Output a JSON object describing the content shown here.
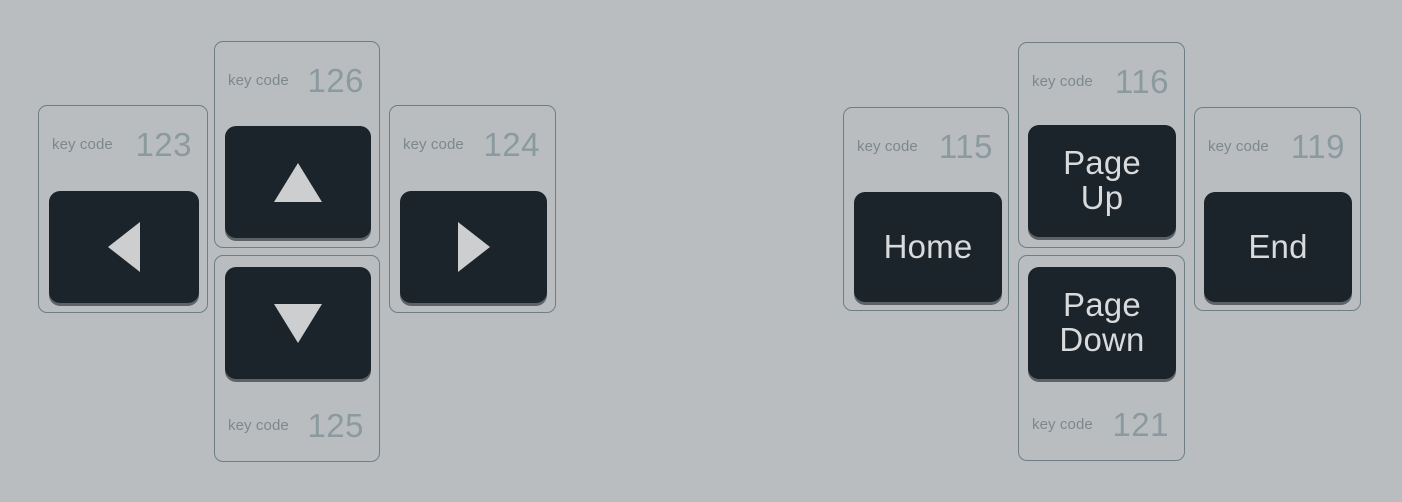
{
  "page": {
    "background_color": "#b9bdc0",
    "card_border_color": "#6d7f85",
    "keycap_color": "#1b242a",
    "keycap_text_color": "#d8dadb",
    "meta_label_color": "#7e888c",
    "meta_code_color": "#8b9a9e",
    "glyph_color": "#ccced0"
  },
  "meta_label": "key code",
  "clusters": [
    {
      "name": "arrow-keys-cluster",
      "keys": [
        {
          "id": "left-arrow",
          "key_code": "123",
          "label": "",
          "glyph": "arrow-left-icon",
          "meta_position": "top"
        },
        {
          "id": "up-arrow",
          "key_code": "126",
          "label": "",
          "glyph": "arrow-up-icon",
          "meta_position": "top"
        },
        {
          "id": "down-arrow",
          "key_code": "125",
          "label": "",
          "glyph": "arrow-down-icon",
          "meta_position": "bottom"
        },
        {
          "id": "right-arrow",
          "key_code": "124",
          "label": "",
          "glyph": "arrow-right-icon",
          "meta_position": "top"
        }
      ]
    },
    {
      "name": "navigation-keys-cluster",
      "keys": [
        {
          "id": "home",
          "key_code": "115",
          "label": "Home",
          "glyph": "",
          "meta_position": "top"
        },
        {
          "id": "page-up",
          "key_code": "116",
          "label": "Page\nUp",
          "glyph": "",
          "meta_position": "top"
        },
        {
          "id": "page-down",
          "key_code": "121",
          "label": "Page\nDown",
          "glyph": "",
          "meta_position": "bottom"
        },
        {
          "id": "end",
          "key_code": "119",
          "label": "End",
          "glyph": "",
          "meta_position": "top"
        }
      ]
    }
  ]
}
